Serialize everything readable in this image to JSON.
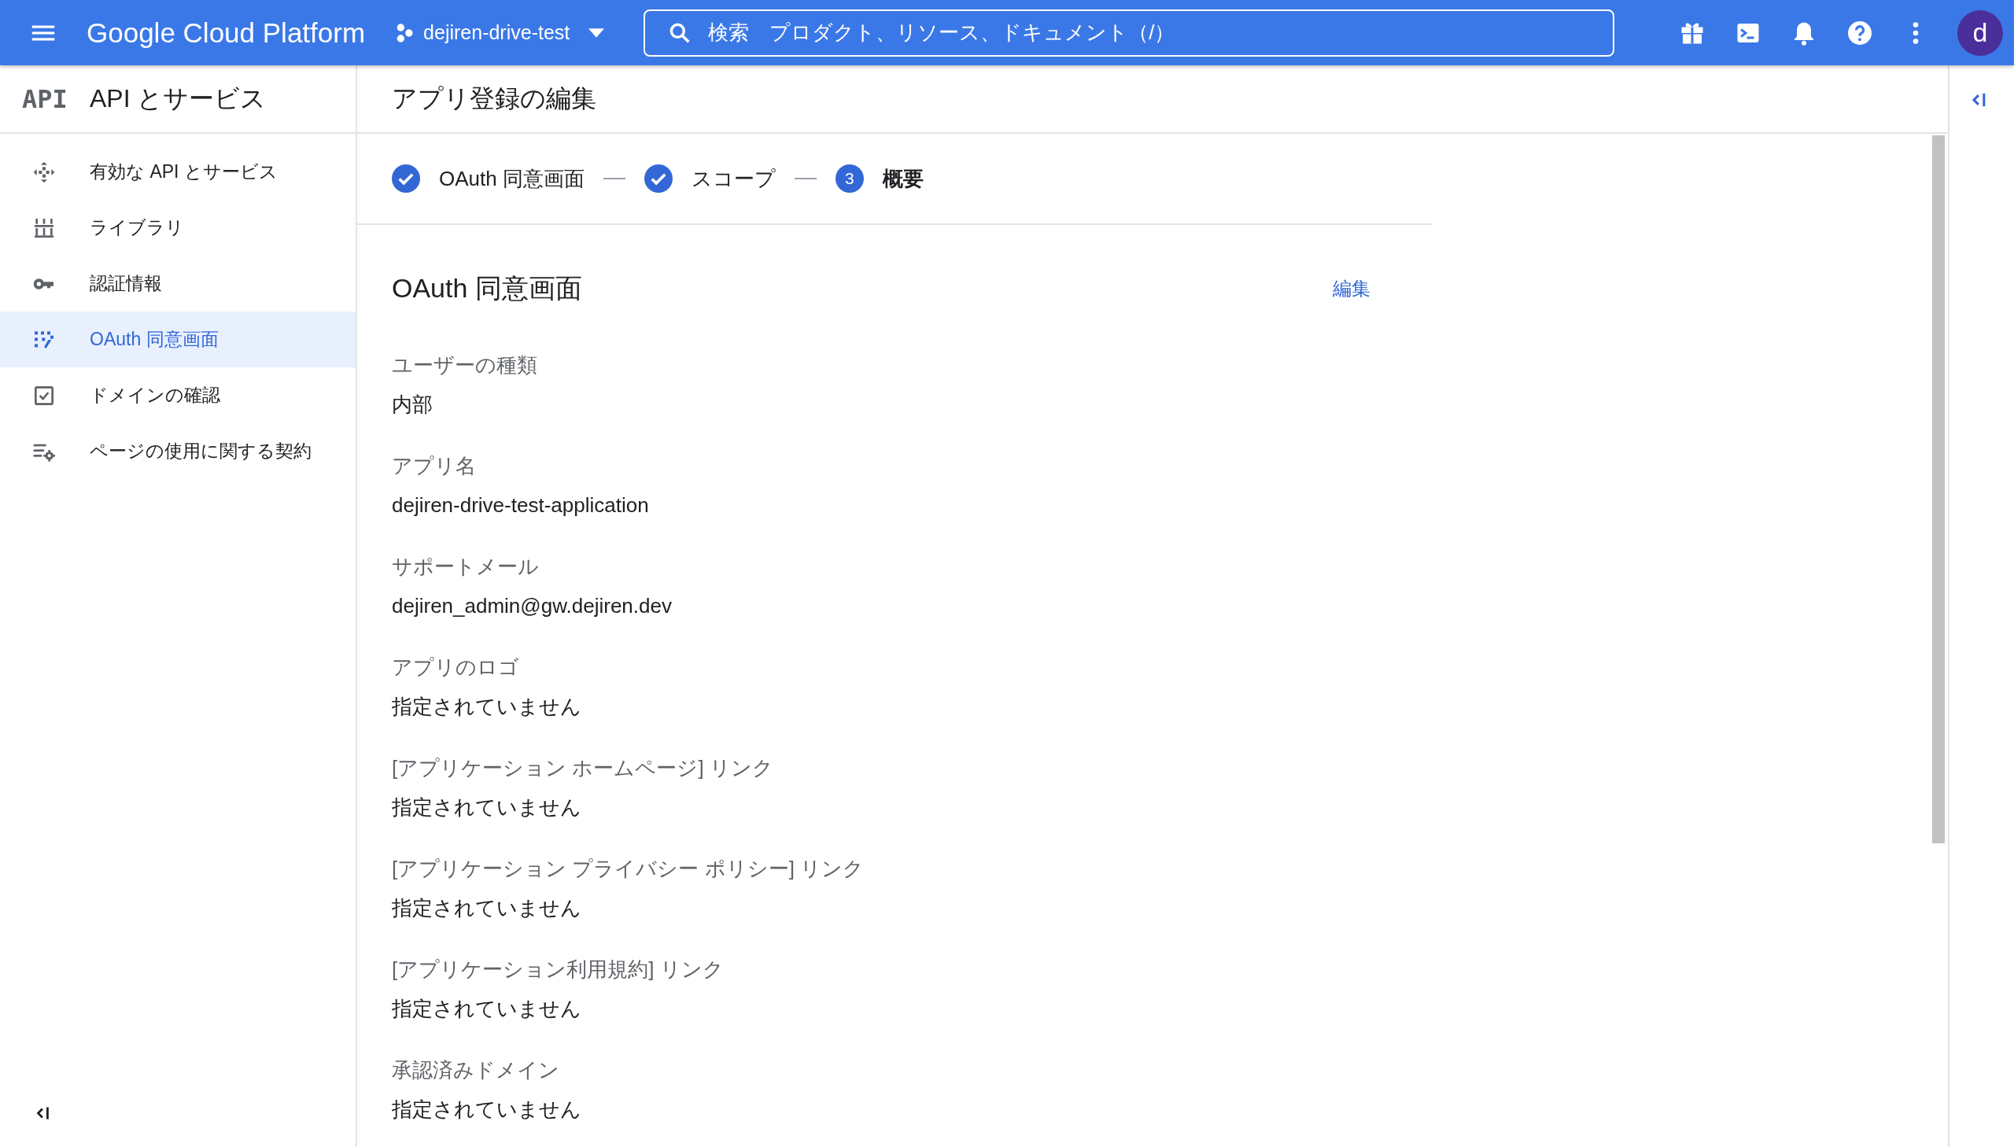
{
  "topbar": {
    "product": "Google Cloud Platform",
    "project": "dejiren-drive-test",
    "search": {
      "placeholder": "検索　プロダクト、リソース、ドキュメント（/）"
    },
    "avatar": "d"
  },
  "sidebar": {
    "logo": "API",
    "title": "API とサービス",
    "items": [
      {
        "label": "有効な API とサービス",
        "selected": false
      },
      {
        "label": "ライブラリ",
        "selected": false
      },
      {
        "label": "認証情報",
        "selected": false
      },
      {
        "label": "OAuth 同意画面",
        "selected": true
      },
      {
        "label": "ドメインの確認",
        "selected": false
      },
      {
        "label": "ページの使用に関する契約",
        "selected": false
      }
    ]
  },
  "main": {
    "title": "アプリ登録の編集",
    "steps": [
      {
        "label": "OAuth 同意画面",
        "completed": true,
        "selected": false
      },
      {
        "label": "スコープ",
        "completed": true,
        "selected": false
      },
      {
        "label": "概要",
        "number": "3",
        "completed": false,
        "selected": true
      }
    ],
    "section": {
      "title": "OAuth 同意画面",
      "edit": "編集",
      "fields": [
        {
          "label": "ユーザーの種類",
          "value": "内部"
        },
        {
          "label": "アプリ名",
          "value": "dejiren-drive-test-application"
        },
        {
          "label": "サポートメール",
          "value": "dejiren_admin@gw.dejiren.dev"
        },
        {
          "label": "アプリのロゴ",
          "value": "指定されていません"
        },
        {
          "label": "[アプリケーション ホームページ] リンク",
          "value": "指定されていません"
        },
        {
          "label": "[アプリケーション プライバシー ポリシー] リンク",
          "value": "指定されていません"
        },
        {
          "label": "[アプリケーション利用規約] リンク",
          "value": "指定されていません"
        },
        {
          "label": "承認済みドメイン",
          "value": "指定されていません"
        }
      ]
    }
  }
}
